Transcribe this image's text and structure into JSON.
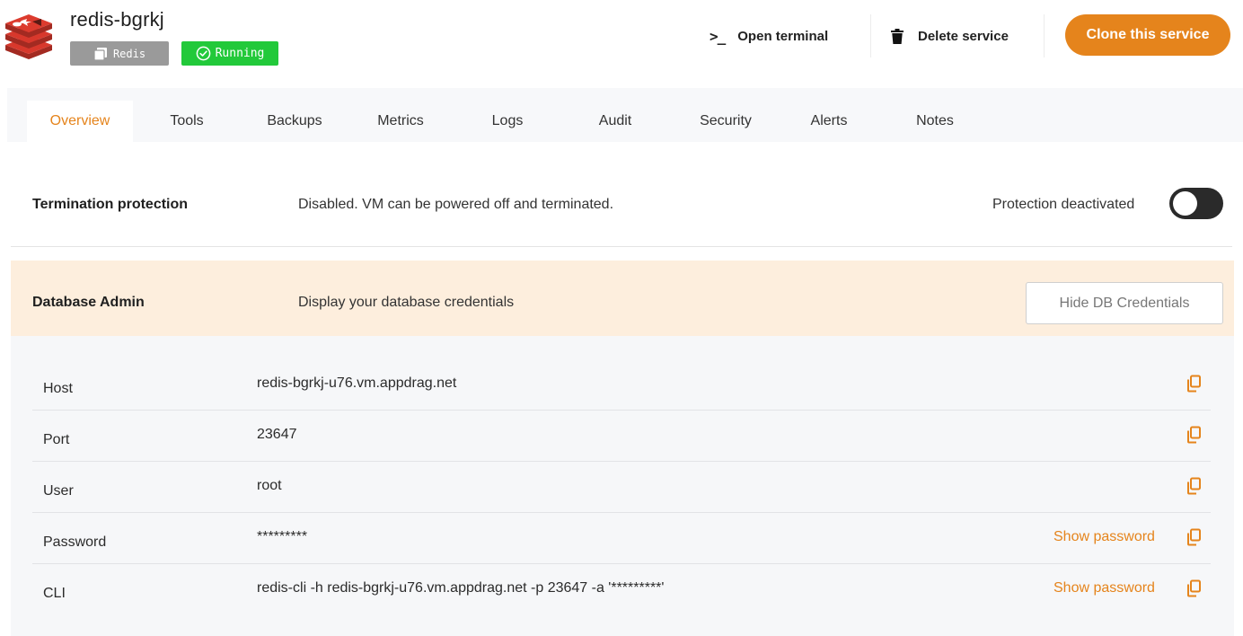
{
  "service": {
    "name": "redis-bgrkj",
    "type_badge": "Redis",
    "status_badge": "Running",
    "logo_icon": "redis-logo-icon",
    "colors": {
      "accent": "#e5841c",
      "running": "#22c93a",
      "type_badge": "#9a9a9a",
      "logo_red": "#d8382c"
    }
  },
  "header_actions": {
    "open_terminal": "Open terminal",
    "terminal_icon": "terminal-icon",
    "delete_service": "Delete service",
    "delete_icon": "trash-icon",
    "clone": "Clone this service"
  },
  "tabs": [
    {
      "label": "Overview",
      "active": true
    },
    {
      "label": "Tools"
    },
    {
      "label": "Backups"
    },
    {
      "label": "Metrics"
    },
    {
      "label": "Logs"
    },
    {
      "label": "Audit"
    },
    {
      "label": "Security"
    },
    {
      "label": "Alerts"
    },
    {
      "label": "Notes"
    }
  ],
  "termination": {
    "label": "Termination protection",
    "description": "Disabled. VM can be powered off and terminated.",
    "state_text": "Protection deactivated",
    "toggle_on": false
  },
  "db_admin": {
    "label": "Database Admin",
    "description": "Display your database credentials",
    "hide_button": "Hide DB Credentials"
  },
  "credentials": [
    {
      "key": "Host",
      "value": "redis-bgrkj-u76.vm.appdrag.net"
    },
    {
      "key": "Port",
      "value": "23647"
    },
    {
      "key": "User",
      "value": "root"
    },
    {
      "key": "Password",
      "value": "*********",
      "action": "Show password"
    },
    {
      "key": "CLI",
      "value": "redis-cli -h redis-bgrkj-u76.vm.appdrag.net -p 23647 -a '*********'",
      "action": "Show password"
    }
  ],
  "copy_icon": "copy-icon"
}
